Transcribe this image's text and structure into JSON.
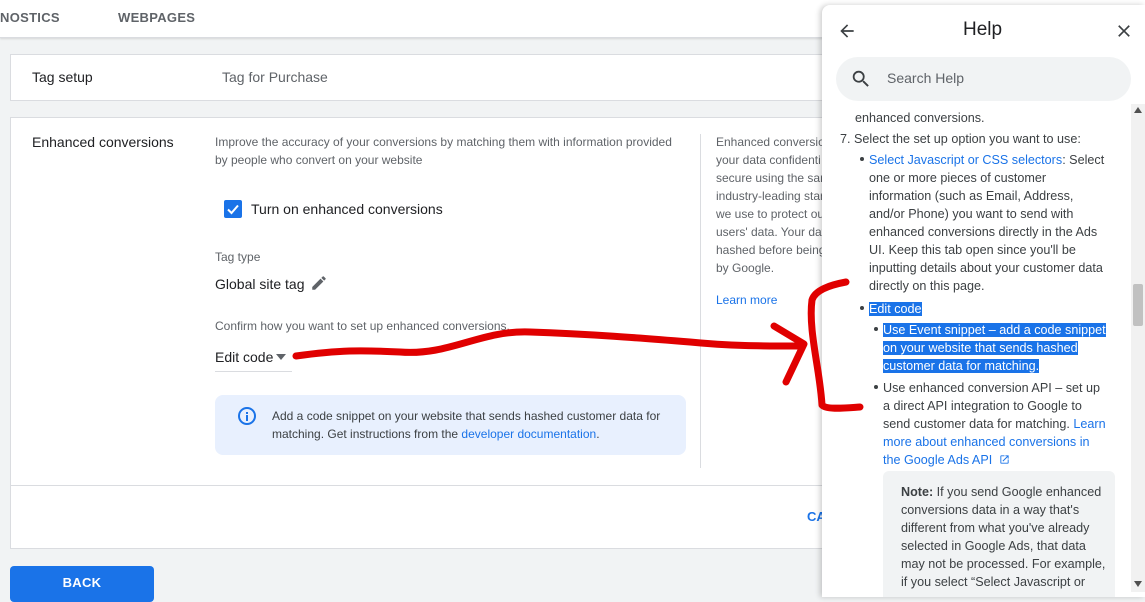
{
  "tabs": [
    "NOSTICS",
    "WEBPAGES"
  ],
  "tag_setup": {
    "label": "Tag setup",
    "value": "Tag for Purchase"
  },
  "enhanced": {
    "label": "Enhanced conversions",
    "description_l1": "Improve the accuracy of your conversions by matching them with information provided",
    "description_l2": "by people who convert on your website",
    "checkbox_label": "Turn on enhanced conversions",
    "checkbox_checked": true,
    "tag_type_label": "Tag type",
    "tag_type_value": "Global site tag",
    "confirm_label": "Confirm how you want to set up enhanced conversions.",
    "method_value": "Edit code",
    "info_l1": "Add a code snippet on your website that sends hashed customer data for",
    "info_l2a": "matching. Get instructions from the ",
    "info_link": "developer documentation",
    "info_l2b": ".",
    "side_lines": [
      "Enhanced conversio",
      "your data confidenti",
      "secure using the sar",
      "industry-leading star",
      "we use to protect ou",
      "users' data. Your dat",
      "hashed before being",
      "by Google."
    ],
    "learn_more": "Learn more"
  },
  "actions": {
    "cancel_partial": "CA",
    "back": "BACK"
  },
  "help": {
    "title": "Help",
    "search_placeholder": "Search Help",
    "top_partial": "enhanced conversions.",
    "step7": "7. Select the set up option you want to use:",
    "opt1_title": "Select Javascript or CSS selectors",
    "opt1_lines": [
      ": Select",
      "one or more pieces of customer",
      "information (such as Email, Address,",
      "and/or Phone) you want to send with",
      "enhanced conversions directly in the Ads",
      "UI. Keep this tab open since you'll be",
      "inputting details about your customer data",
      "directly on this page."
    ],
    "edit_code": "Edit code",
    "event_lines": [
      "Use Event snippet – add a code snippet",
      "on your website that sends hashed",
      "customer data for matching."
    ],
    "api_title": "Use enhanced conversion API",
    "api_rest_l1": " – set up",
    "api_lines": [
      "a direct API integration to Google to",
      "send customer data for matching. "
    ],
    "api_link_l1": "Learn",
    "api_link_lines": [
      "more about enhanced conversions in",
      "the Google Ads API"
    ],
    "note_label": "Note:",
    "note_l1": " If you send Google enhanced",
    "note_lines": [
      "conversions data in a way that's",
      "different from what you've already",
      "selected in Google Ads, that data",
      "may not be processed. For example,",
      "if you select “Select Javascript or"
    ]
  },
  "colors": {
    "accent": "#1a73e8",
    "annotation": "#e00000"
  }
}
